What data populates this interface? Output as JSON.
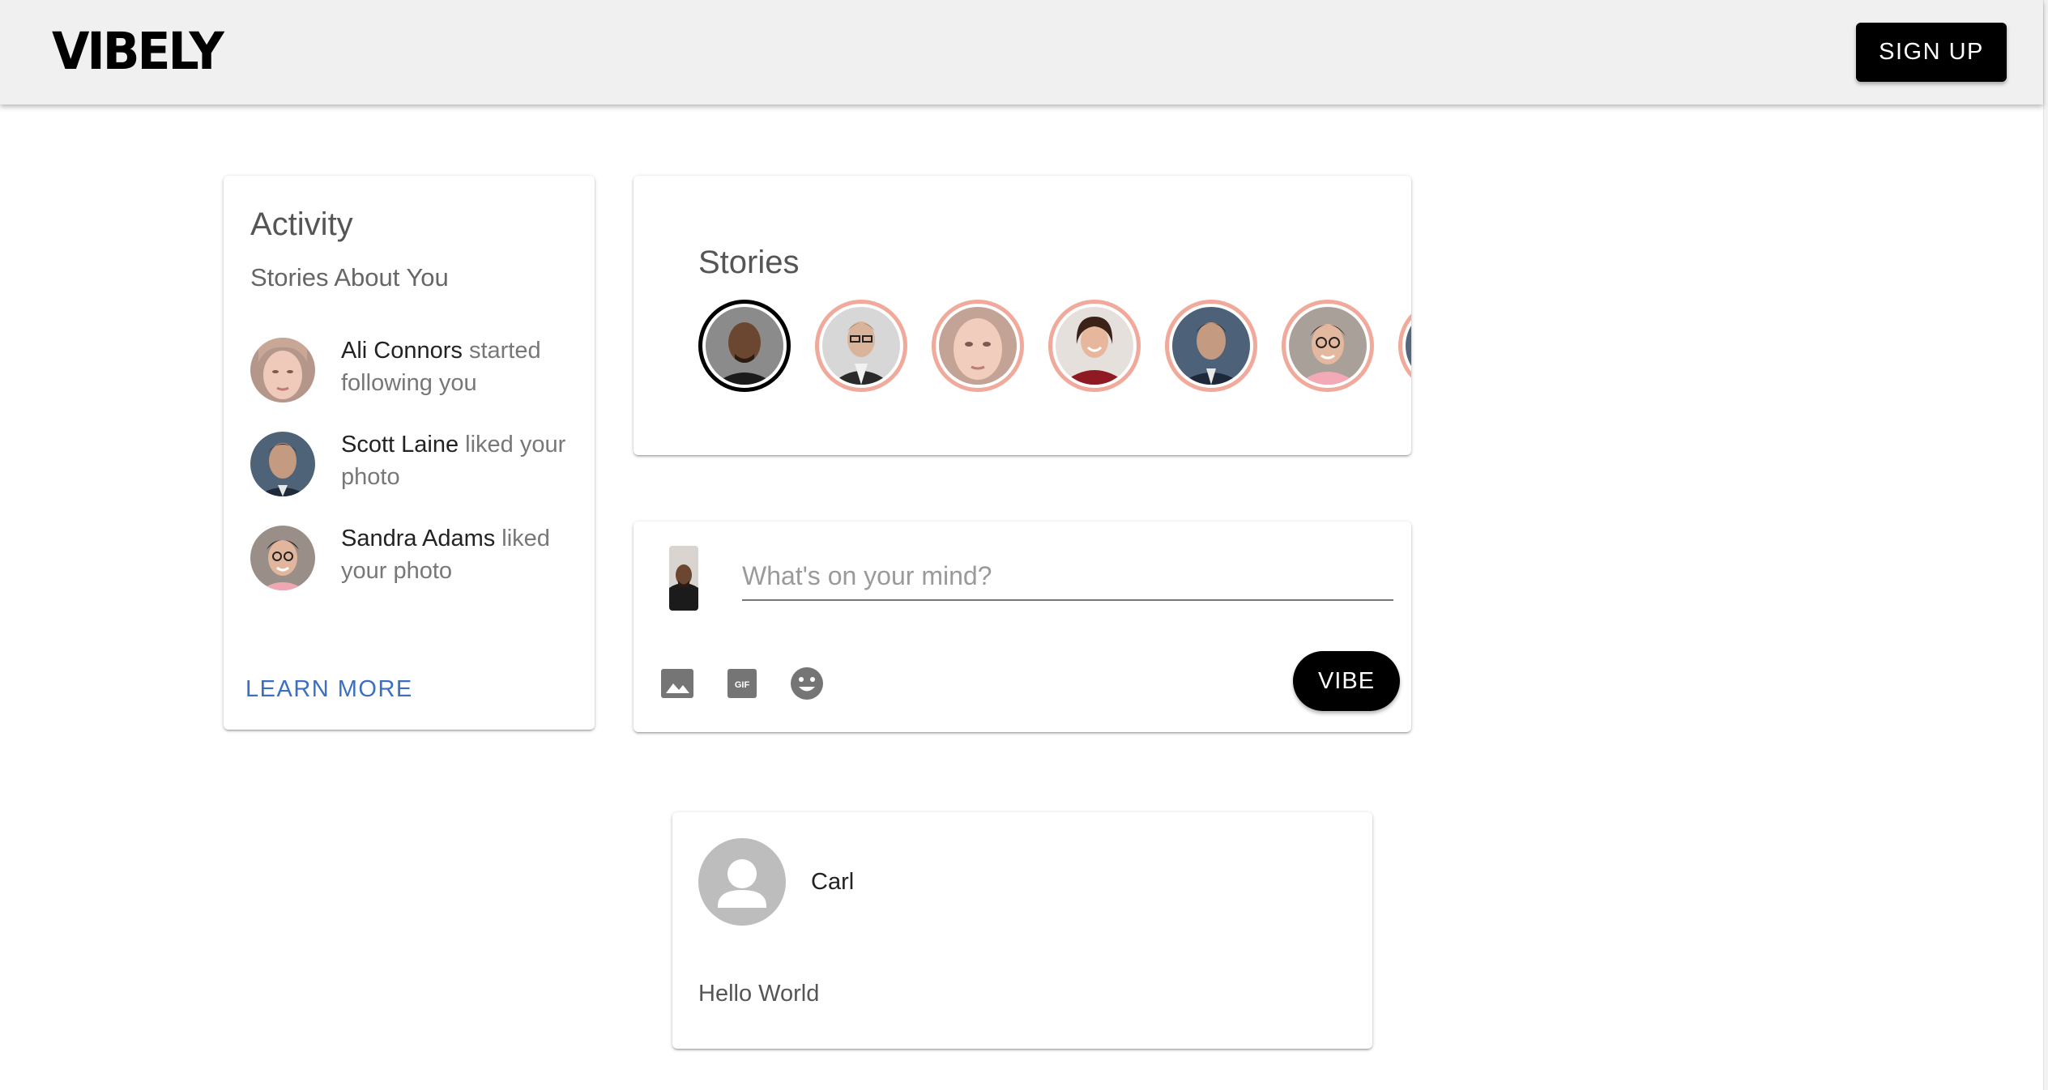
{
  "app": {
    "logo": "VIBELY",
    "signup_label": "SIGN UP"
  },
  "activity": {
    "title": "Activity",
    "subtitle": "Stories About You",
    "items": [
      {
        "name": "Ali Connors",
        "action": " started following you"
      },
      {
        "name": "Scott Laine",
        "action": " liked your photo"
      },
      {
        "name": "Sandra Adams",
        "action": " liked your photo"
      }
    ],
    "learn_more_label": "LEARN MORE"
  },
  "stories": {
    "title": "Stories"
  },
  "composer": {
    "placeholder": "What's on your mind?",
    "vibe_label": "VIBE",
    "gif_icon_text": "GIF"
  },
  "post": {
    "author": "Carl",
    "body": "Hello World"
  },
  "colors": {
    "appbar_bg": "#f0f0f0",
    "primary_button": "#000000",
    "link": "#3b6fbf",
    "story_ring": "#f0a99b",
    "story_ring_active": "#000000"
  }
}
